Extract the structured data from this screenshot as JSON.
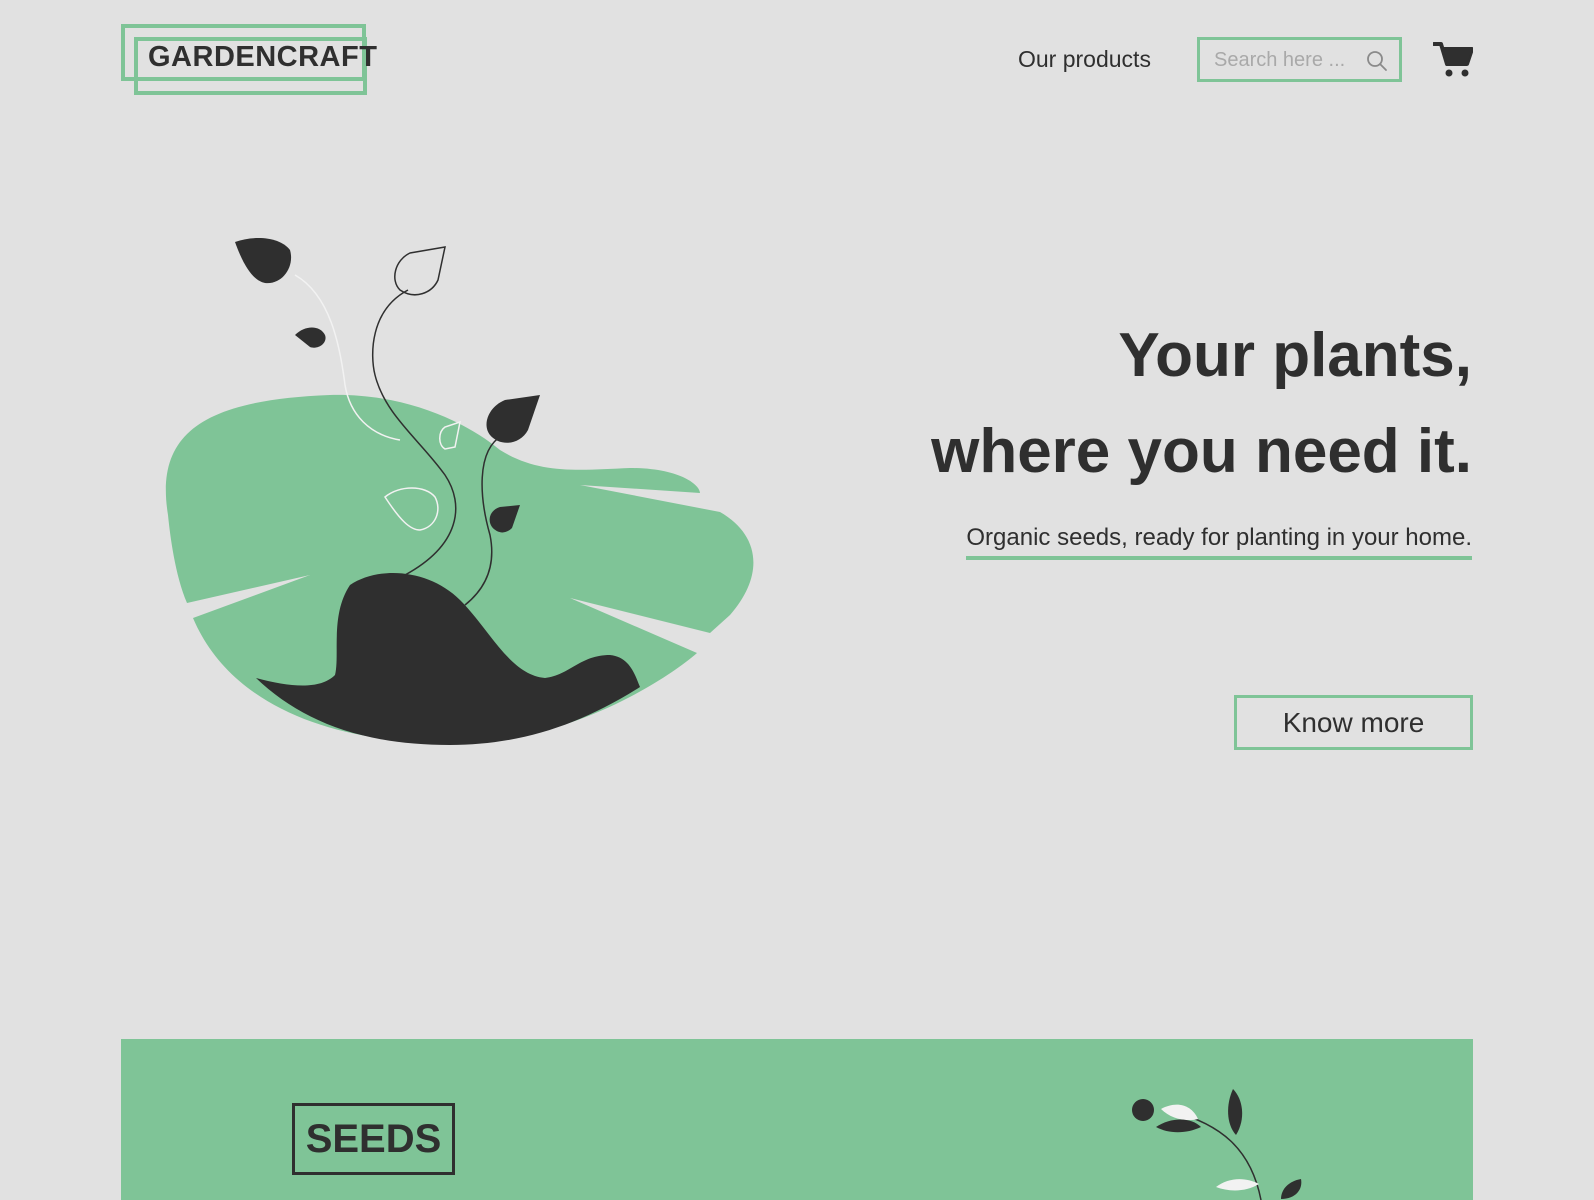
{
  "header": {
    "logo_text": "GARDENCRAFT",
    "nav": {
      "products_label": "Our products"
    },
    "search": {
      "placeholder": "Search here ..."
    },
    "icons": {
      "search": "search-icon",
      "cart": "cart-icon"
    }
  },
  "hero": {
    "headline_line1": "Your  plants,",
    "headline_line2": "where you need it.",
    "tagline": "Organic seeds, ready for planting in your home.",
    "cta_label": "Know more"
  },
  "section": {
    "seeds_label": "SEEDS"
  },
  "colors": {
    "accent": "#7fc497",
    "dark": "#2f2f2f",
    "background": "#e1e1e1"
  }
}
